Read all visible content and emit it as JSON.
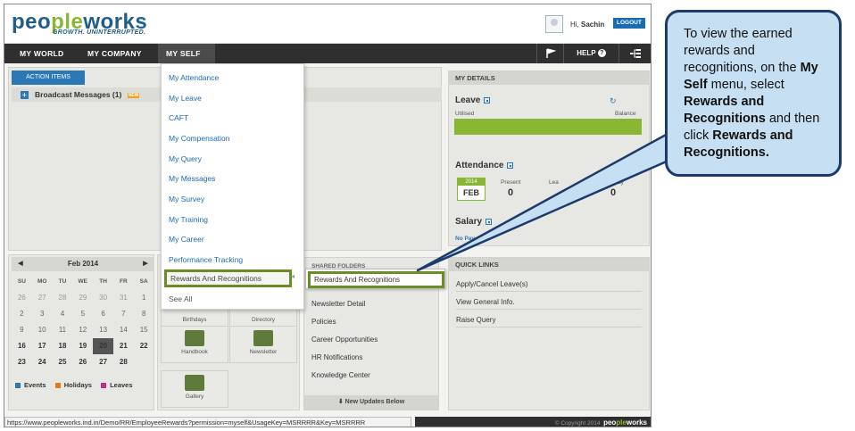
{
  "header": {
    "logo_part1": "peo",
    "logo_part2": "ple",
    "logo_part3": "w",
    "logo_part4": "orks",
    "tagline": "GROWTH. UNINTERRUPTED.",
    "greeting_prefix": "Hi, ",
    "user_name": "Sachin",
    "logout_label": "LOGOUT"
  },
  "nav": {
    "tabs": [
      "MY WORLD",
      "MY COMPANY",
      "MY SELF"
    ],
    "active_tab": "MY SELF",
    "help_label": "HELP",
    "icons": [
      "flag-icon",
      "help-icon",
      "sitemap-icon"
    ]
  },
  "action_items": {
    "tab_label": "ACTION ITEMS",
    "broadcast": "Broadcast Messages (1)",
    "new_badge": "NEW"
  },
  "my_self_menu": {
    "items": [
      "My Attendance",
      "My Leave",
      "CAFT",
      "My Compensation",
      "My Query",
      "My Messages",
      "My Survey",
      "My Training",
      "My Career",
      "Performance Tracking",
      "Rewards And Recognitions",
      "See All"
    ],
    "highlighted": "Rewards And Recognitions"
  },
  "submenu": {
    "item": "Rewards And Recognitions"
  },
  "calendar": {
    "month_label": "Feb 2014",
    "prev": "◀",
    "next": "▶",
    "days_of_week": [
      "SU",
      "MO",
      "TU",
      "WE",
      "TH",
      "FR",
      "SA"
    ],
    "weeks": [
      [
        "26",
        "27",
        "28",
        "29",
        "30",
        "31",
        "1"
      ],
      [
        "2",
        "3",
        "4",
        "5",
        "6",
        "7",
        "8"
      ],
      [
        "9",
        "10",
        "11",
        "12",
        "13",
        "14",
        "15"
      ],
      [
        "16",
        "17",
        "18",
        "19",
        "20",
        "21",
        "22"
      ],
      [
        "23",
        "24",
        "25",
        "26",
        "27",
        "28",
        ""
      ]
    ],
    "today": "20",
    "legend": [
      {
        "label": "Events",
        "color": "#2b78b7"
      },
      {
        "label": "Holidays",
        "color": "#e07b20"
      },
      {
        "label": "Leaves",
        "color": "#c0308a"
      }
    ]
  },
  "quick_tiles": [
    {
      "label": "Birthdays",
      "icon": "cake-icon"
    },
    {
      "label": "Directory",
      "icon": "directory-icon"
    },
    {
      "label": "Handbook",
      "icon": "book-icon"
    },
    {
      "label": "Newsletter",
      "icon": "newspaper-icon"
    },
    {
      "label": "Gallery",
      "icon": "gallery-icon"
    }
  ],
  "shared_folders": {
    "title": "SHARED FOLDERS",
    "items": [
      "Newsletter Detail",
      "Policies",
      "Career Opportunities",
      "HR Notifications",
      "Knowledge Center"
    ],
    "updates": "New Updates Below"
  },
  "my_details": {
    "title": "MY DETAILS",
    "leave": {
      "label": "Leave",
      "utilised": "Utilised",
      "balance": "Balance"
    },
    "attendance": {
      "label": "Attendance",
      "year": "2014",
      "month": "FEB",
      "present_label": "Present",
      "present_value": "0",
      "leave_label": "Lea",
      "halfpay_label": "alf Pay",
      "halfpay_value": "0"
    },
    "salary": {
      "label": "Salary",
      "no_pay": "No Pay"
    }
  },
  "quick_links": {
    "title": "QUICK LINKS",
    "items": [
      "Apply/Cancel Leave(s)",
      "View General Info.",
      "Raise Query"
    ]
  },
  "status_url": "https://www.peopleworks.ind.in/Demo/RR/EmployeeRewards?permission=myself&UsageKey=MSRRRR&Key=MSRRRR",
  "footer": {
    "copyright": "© Copyright 2014",
    "brand_part1": "peo",
    "brand_part2": "ple",
    "brand_part3": "w",
    "brand_part4": "orks"
  },
  "callout": {
    "text1": "To view the earned rewards and recognitions, on the ",
    "bold1": "My Self",
    "text2": " menu, select ",
    "bold2": "Rewards and Recognitions",
    "text3": " and then click ",
    "bold3": "Rewards and Recognitions."
  },
  "colors": {
    "brand_blue": "#1f5d8a",
    "brand_green": "#8ab733",
    "nav_dark": "#2f2f2f",
    "highlight_green": "#6b8e23",
    "callout_fill": "#c6dff2",
    "callout_border": "#1c3a6b"
  }
}
